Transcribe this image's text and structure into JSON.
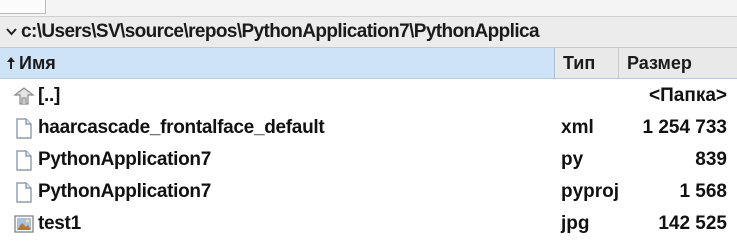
{
  "path": "c:\\Users\\SV\\source\\repos\\PythonApplication7\\PythonApplica",
  "columns": {
    "name": "Имя",
    "type": "Тип",
    "size": "Размер"
  },
  "parent_row": {
    "name": "[..]",
    "size": "<Папка>",
    "icon": "folder-up-icon"
  },
  "files": [
    {
      "name": "haarcascade_frontalface_default",
      "type": "xml",
      "size": "1 254 733",
      "icon": "file-icon"
    },
    {
      "name": "PythonApplication7",
      "type": "py",
      "size": "839",
      "icon": "file-icon"
    },
    {
      "name": "PythonApplication7",
      "type": "pyproj",
      "size": "1 568",
      "icon": "file-icon"
    },
    {
      "name": "test1",
      "type": "jpg",
      "size": "142 525",
      "icon": "image-file-icon"
    }
  ],
  "colors": {
    "header_active": "#cfe3f6",
    "header": "#e9e9e9",
    "pathbar": "#ececec"
  }
}
